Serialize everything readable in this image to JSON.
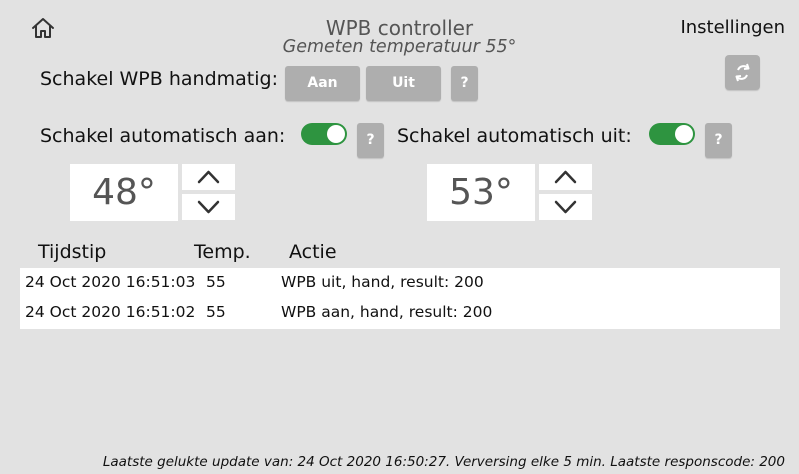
{
  "header": {
    "title": "WPB controller",
    "subtitle": "Gemeten temperatuur 55°",
    "settings_label": "Instellingen",
    "home_icon": "home-icon",
    "refresh_icon": "refresh-icon"
  },
  "manual": {
    "label": "Schakel WPB handmatig:",
    "on_label": "Aan",
    "off_label": "Uit",
    "help_label": "?"
  },
  "auto_on": {
    "label": "Schakel automatisch aan:",
    "enabled": true,
    "help_label": "?",
    "temperature": "48°"
  },
  "auto_off": {
    "label": "Schakel automatisch uit:",
    "enabled": true,
    "help_label": "?",
    "temperature": "53°"
  },
  "log": {
    "columns": [
      "Tijdstip",
      "Temp.",
      "Actie"
    ],
    "rows": [
      [
        "24 Oct 2020 16:51:03",
        "55",
        "WPB uit, hand, result: 200"
      ],
      [
        "24 Oct 2020 16:51:02",
        "55",
        "WPB aan, hand, result: 200"
      ]
    ]
  },
  "footer": {
    "status": "Laatste gelukte update van: 24 Oct 2020 16:50:27. Verversing elke 5 min. Laatste responscode: 200"
  },
  "colors": {
    "background": "#e2e2e2",
    "button": "#aeaeae",
    "toggle_on": "#2e9440",
    "text_muted": "#555555"
  }
}
